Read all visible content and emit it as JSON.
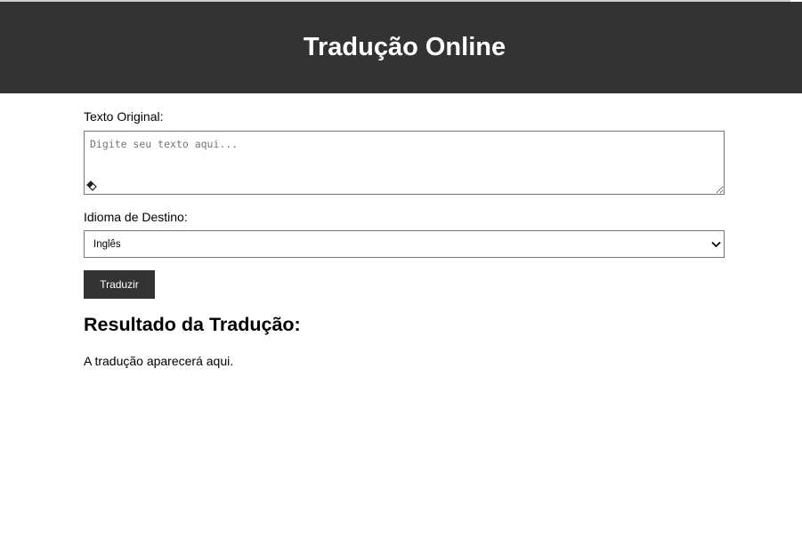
{
  "header": {
    "title": "Tradução Online"
  },
  "form": {
    "original_label": "Texto Original:",
    "original_placeholder": "Digite seu texto aqui...",
    "original_value": "",
    "target_label": "Idioma de Destino:",
    "target_selected": "Inglês",
    "translate_button": "Traduzir"
  },
  "result": {
    "heading": "Resultado da Tradução:",
    "text": "A tradução aparecerá aqui."
  },
  "colors": {
    "header_bg": "#333333",
    "button_bg": "#333333",
    "text": "#000000"
  },
  "icons": {
    "textarea_corner": "eraser-icon",
    "select_arrow": "chevron-down-icon"
  }
}
